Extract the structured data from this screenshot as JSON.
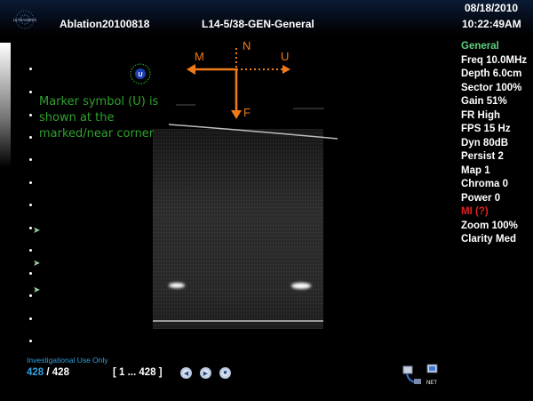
{
  "header": {
    "logo_text": "ULTRASONIX",
    "study": "Ablation20100818",
    "probe": "L14-5/38-GEN-General",
    "date": "08/18/2010",
    "time": "10:22:49AM"
  },
  "annotation": {
    "note": "Marker symbol (U) is shown at the marked/near corner",
    "marker_symbol": "U",
    "orientation": {
      "n": "N",
      "m": "M",
      "u": "U",
      "f": "F"
    }
  },
  "params": [
    {
      "text": "General",
      "color": "#5fd07f"
    },
    {
      "text": "Freq 10.0MHz",
      "color": "#ffffff"
    },
    {
      "text": "Depth 6.0cm",
      "color": "#ffffff"
    },
    {
      "text": "Sector 100%",
      "color": "#ffffff"
    },
    {
      "text": "Gain 51%",
      "color": "#ffffff"
    },
    {
      "text": "FR High",
      "color": "#ffffff"
    },
    {
      "text": "FPS 15 Hz",
      "color": "#ffffff"
    },
    {
      "text": "Dyn 80dB",
      "color": "#ffffff"
    },
    {
      "text": "Persist 2",
      "color": "#ffffff"
    },
    {
      "text": "Map 1",
      "color": "#ffffff"
    },
    {
      "text": "Chroma 0",
      "color": "#ffffff"
    },
    {
      "text": "Power 0",
      "color": "#ffffff"
    },
    {
      "text": "MI (?)",
      "color": "#e02020"
    },
    {
      "text": "Zoom 100%",
      "color": "#ffffff"
    },
    {
      "text": "Clarity Med",
      "color": "#ffffff"
    }
  ],
  "footer": {
    "investigational": "Investigational Use Only",
    "current_frame": "428",
    "total_frames": "/ 428",
    "range": "[ 1 ... 428 ]",
    "controls": [
      "rewind-icon",
      "play-icon",
      "stop-icon"
    ]
  },
  "colors": {
    "accent": "#33a0e0",
    "annotation": "#2fa12f",
    "orientation": "#f07b18"
  }
}
